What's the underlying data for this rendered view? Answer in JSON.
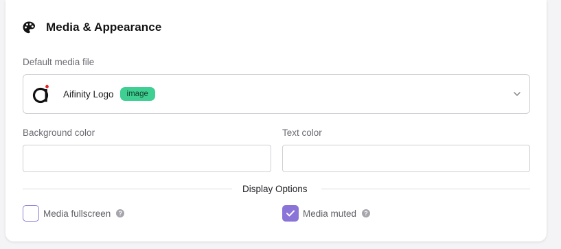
{
  "section": {
    "title": "Media & Appearance",
    "icon": "palette-icon"
  },
  "media": {
    "label": "Default media file",
    "selected_name": "Aifinity Logo",
    "selected_type": "image",
    "badge_color": "#3fcf93"
  },
  "colors": {
    "background_label": "Background color",
    "background_value": "",
    "text_label": "Text color",
    "text_value": ""
  },
  "display_options": {
    "heading": "Display Options",
    "fullscreen_label": "Media fullscreen",
    "fullscreen_checked": false,
    "muted_label": "Media muted",
    "muted_checked": true,
    "help_glyph": "?"
  },
  "accent_color": "#8b74d8"
}
